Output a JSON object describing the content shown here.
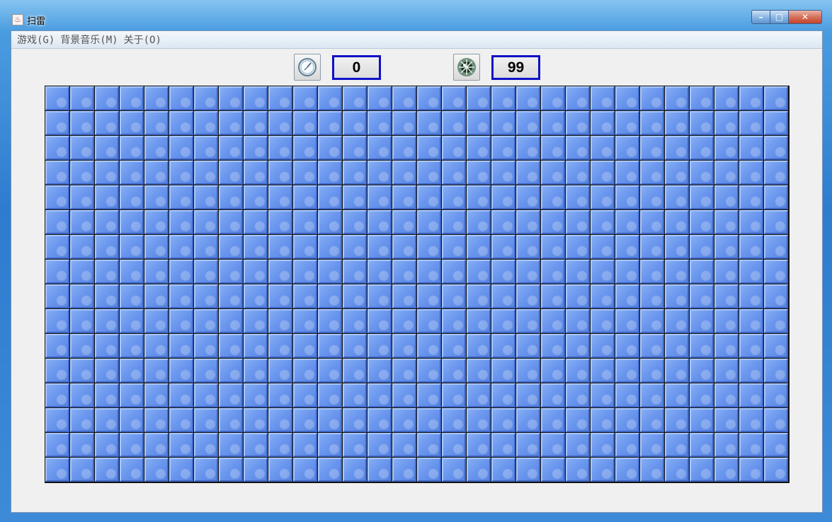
{
  "window": {
    "title": "扫雷",
    "minimize_symbol": "–",
    "maximize_symbol": "□",
    "close_symbol": "✕"
  },
  "menu": {
    "items": [
      {
        "label": "游戏(G)"
      },
      {
        "label": "背景音乐(M)"
      },
      {
        "label": "关于(O)"
      }
    ]
  },
  "status": {
    "timer_icon": "clock-icon",
    "timer_value": "0",
    "mine_icon": "mine-icon",
    "mines_remaining": "99"
  },
  "board": {
    "columns": 30,
    "rows": 16,
    "cell_state": "covered",
    "cell_color": "#6b97ee"
  },
  "colors": {
    "counter_border": "#1010c8",
    "cell_highlight": "#a9c6fb",
    "cell_shadow": "#3e66c4"
  }
}
